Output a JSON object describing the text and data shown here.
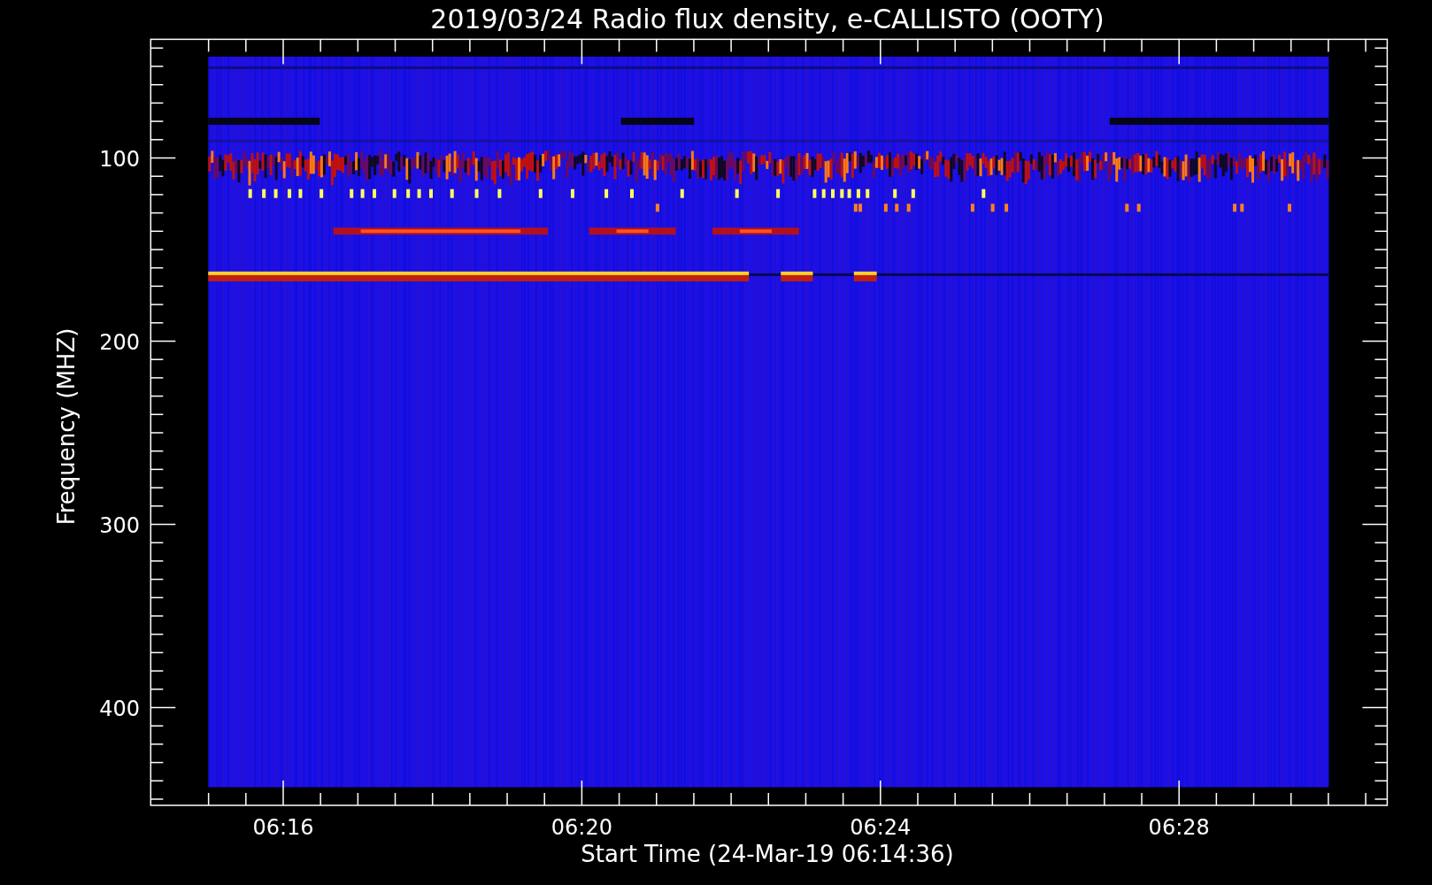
{
  "chart": {
    "title": "2019/03/24  Radio flux density, e-CALLISTO (OOTY)",
    "ylabel": "Frequency (MHZ)",
    "xlabel": "Start Time (24-Mar-19 06:14:36)",
    "yticks": [
      "100",
      "200",
      "300",
      "400"
    ],
    "xticks": [
      "06:16",
      "06:20",
      "06:24",
      "06:28"
    ]
  }
}
